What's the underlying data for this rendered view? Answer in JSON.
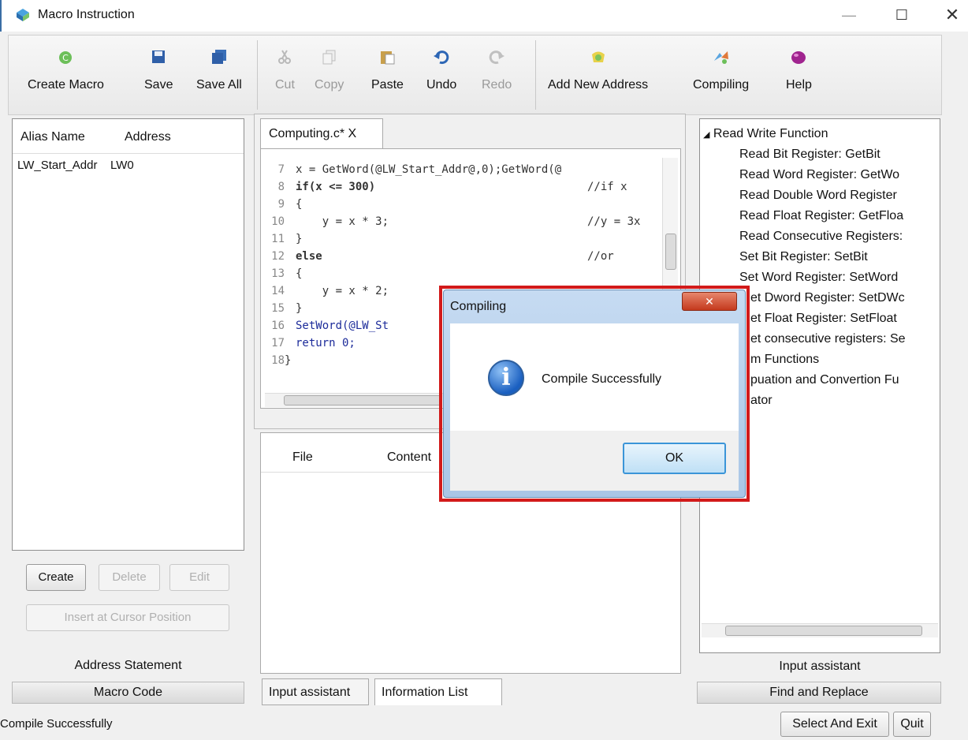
{
  "window": {
    "title": "Macro Instruction",
    "controls": {
      "minimize": "—",
      "maximize": "☐",
      "close": "✕"
    }
  },
  "toolbar": {
    "create_macro": "Create Macro",
    "save": "Save",
    "save_all": "Save All",
    "cut": "Cut",
    "copy": "Copy",
    "paste": "Paste",
    "undo": "Undo",
    "redo": "Redo",
    "add_new_address": "Add New Address",
    "compiling": "Compiling",
    "help": "Help"
  },
  "address_panel": {
    "columns": [
      "Alias Name",
      "Address"
    ],
    "rows": [
      {
        "alias": "LW_Start_Addr",
        "address": "LW0"
      }
    ],
    "buttons": {
      "create": "Create",
      "delete": "Delete",
      "edit": "Edit",
      "insert": "Insert at Cursor Position"
    },
    "label": "Address Statement",
    "tab": "Macro Code"
  },
  "editor": {
    "tab_label": "Computing.c* X",
    "lines": [
      {
        "n": "7",
        "code": "x = GetWord(@LW_Start_Addr@,0);GetWord(@"
      },
      {
        "n": "8",
        "code": "if(x <= 300)",
        "comment": "//if x"
      },
      {
        "n": "9",
        "code": "{"
      },
      {
        "n": "10",
        "code": "    y = x * 3;",
        "comment": "//y = 3x"
      },
      {
        "n": "11",
        "code": "}"
      },
      {
        "n": "12",
        "code": "else",
        "comment": "//or"
      },
      {
        "n": "13",
        "code": "{"
      },
      {
        "n": "14",
        "code": "    y = x * 2;"
      },
      {
        "n": "15",
        "code": "}"
      },
      {
        "n": "16",
        "code": "SetWord(@LW_St"
      },
      {
        "n": "17",
        "code": "return 0;"
      },
      {
        "n": "18",
        "code": "}"
      }
    ]
  },
  "info_list": {
    "columns": [
      "File",
      "Content"
    ]
  },
  "bottom_tabs": {
    "input_assistant": "Input assistant",
    "information_list": "Information List"
  },
  "function_tree": {
    "root": "Read Write Function",
    "items": [
      "Read Bit Register: GetBit",
      "Read Word Register: GetWo",
      "Read Double Word Register",
      "Read Float Register: GetFloa",
      "Read Consecutive Registers:",
      "Set Bit Register: SetBit",
      "Set Word Register: SetWord",
      "et Dword Register: SetDWc",
      "et Float Register: SetFloat",
      "et consecutive registers: Se",
      "m Functions",
      "puation and Convertion Fu",
      "ator"
    ],
    "label": "Input assistant",
    "tab": "Find and Replace"
  },
  "status": {
    "message": "Compile Successfully",
    "select_and_exit": "Select And Exit",
    "quit": "Quit"
  },
  "dialog": {
    "title": "Compiling",
    "message": "Compile Successfully",
    "ok": "OK",
    "close": "✕",
    "icon": "info-icon",
    "highlight_color": "#d21a1a"
  }
}
